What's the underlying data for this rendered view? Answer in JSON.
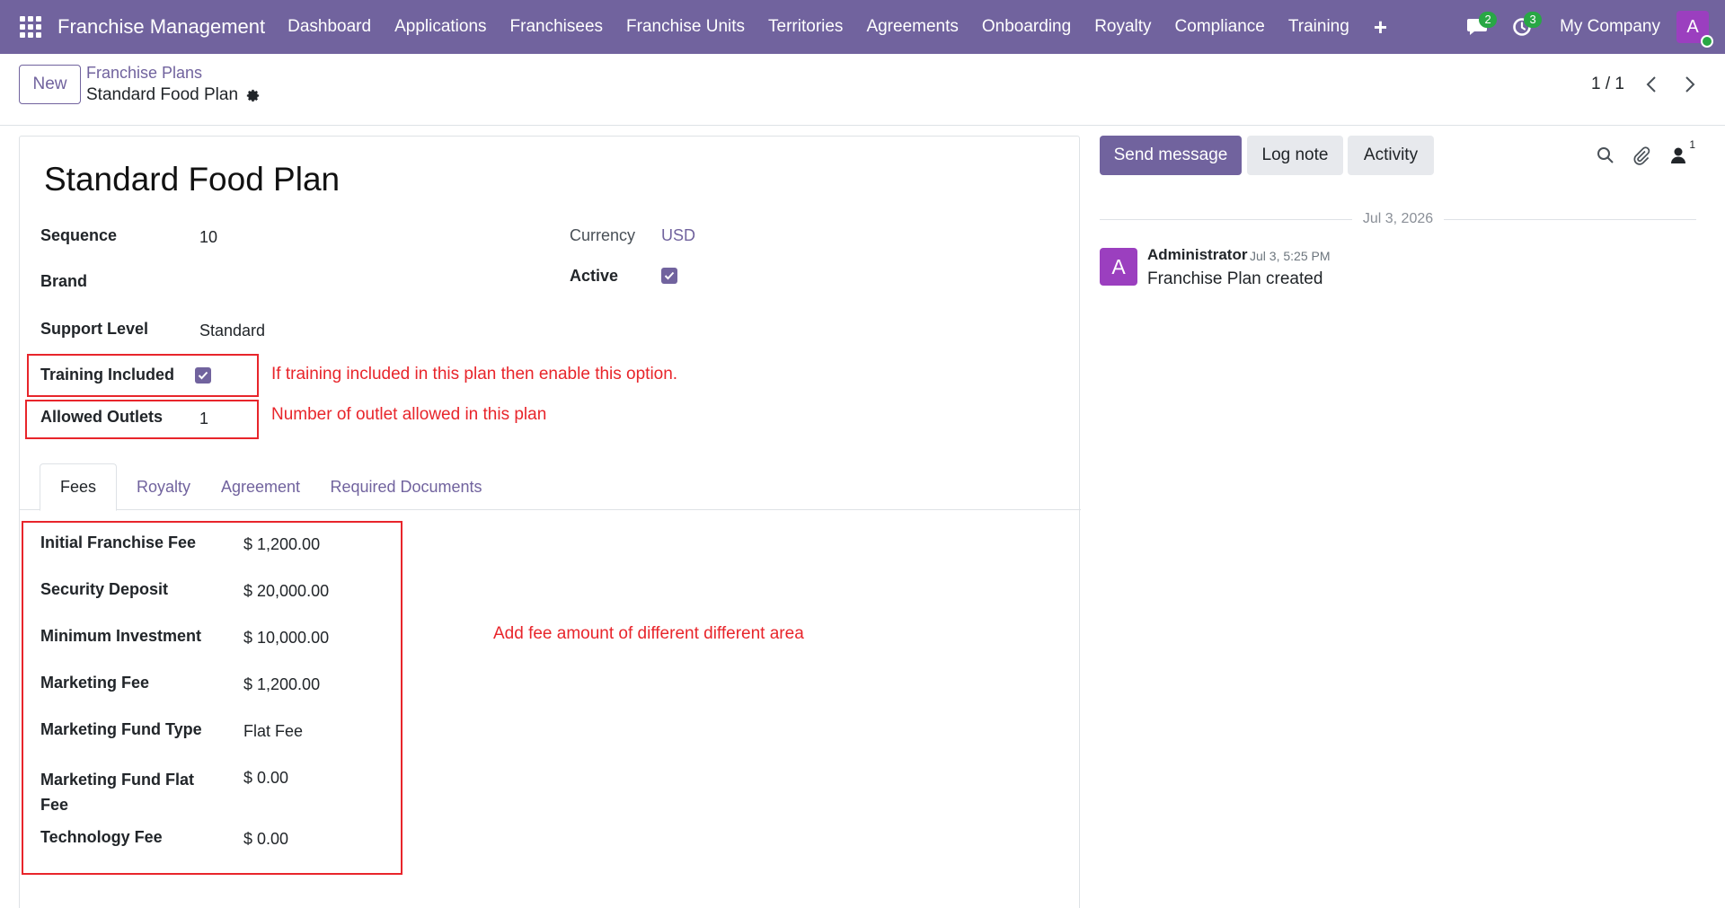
{
  "navbar": {
    "brand": "Franchise Management",
    "items": [
      "Dashboard",
      "Applications",
      "Franchisees",
      "Franchise Units",
      "Territories",
      "Agreements",
      "Onboarding",
      "Royalty",
      "Compliance",
      "Training"
    ],
    "messages_count": "2",
    "activities_count": "3",
    "company": "My Company",
    "user_initial": "A",
    "accent": "#71639e"
  },
  "control_panel": {
    "new_label": "New",
    "breadcrumb_parent": "Franchise Plans",
    "breadcrumb_current": "Standard Food Plan",
    "pager": "1 / 1"
  },
  "form": {
    "title": "Standard Food Plan",
    "sequence_label": "Sequence",
    "sequence_value": "10",
    "brand_label": "Brand",
    "support_level_label": "Support Level",
    "support_level_value": "Standard",
    "training_included_label": "Training Included",
    "training_included_checked": true,
    "allowed_outlets_label": "Allowed Outlets",
    "allowed_outlets_value": "1",
    "currency_label": "Currency",
    "currency_value": "USD",
    "active_label": "Active",
    "active_checked": true
  },
  "annotations": {
    "training": "If training included in this plan then enable this option.",
    "outlets": "Number of outlet allowed in this plan",
    "fees": "Add fee amount of different different area"
  },
  "tabs": [
    "Fees",
    "Royalty",
    "Agreement",
    "Required Documents"
  ],
  "fees": [
    {
      "label": "Initial Franchise Fee",
      "value": "$ 1,200.00"
    },
    {
      "label": "Security Deposit",
      "value": "$ 20,000.00"
    },
    {
      "label": "Minimum Investment",
      "value": "$ 10,000.00"
    },
    {
      "label": "Marketing Fee",
      "value": "$ 1,200.00"
    },
    {
      "label": "Marketing Fund Type",
      "value": "Flat Fee"
    },
    {
      "label": "Marketing Fund Flat Fee",
      "value": "$ 0.00"
    },
    {
      "label": "Technology Fee",
      "value": "$ 0.00"
    }
  ],
  "chatter": {
    "send_message": "Send message",
    "log_note": "Log note",
    "activity": "Activity",
    "followers_count": "1",
    "date_separator": "Jul 3, 2026",
    "author_initial": "A",
    "author": "Administrator",
    "message_date": "Jul 3, 5:25 PM",
    "message_body": "Franchise Plan created"
  }
}
